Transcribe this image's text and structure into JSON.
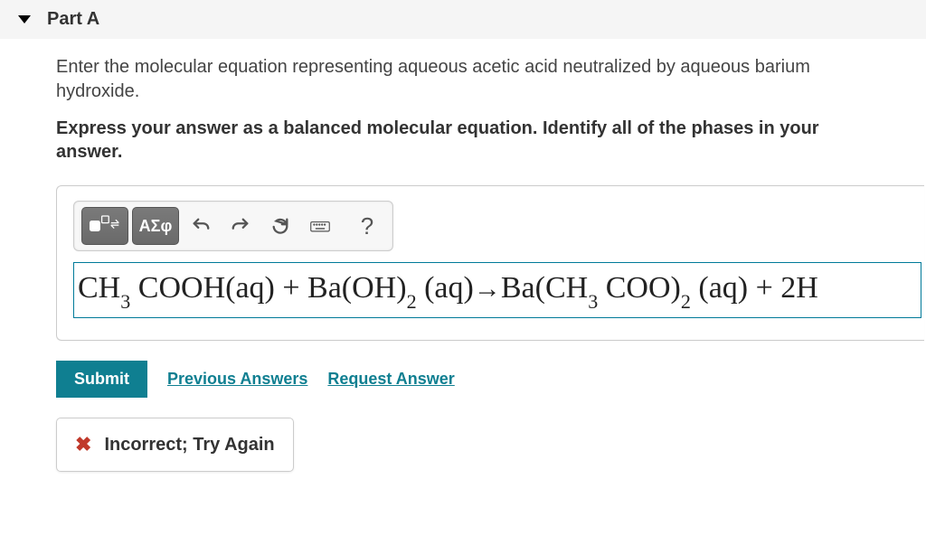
{
  "part": {
    "title": "Part A"
  },
  "question": {
    "prompt": "Enter the molecular equation representing aqueous acetic acid neutralized by aqueous barium hydroxide.",
    "instructions": "Express your answer as a balanced molecular equation. Identify all of the phases in your answer."
  },
  "toolbar": {
    "symbols_label": "ΑΣφ",
    "help_label": "?"
  },
  "answer": {
    "equation_html": "CH<sub>3</sub> COOH(aq) + Ba(OH)<sub>2</sub> (aq)<span class='arrow'>→</span>Ba(CH<sub>3</sub> COO)<sub>2</sub> (aq) + 2H"
  },
  "actions": {
    "submit": "Submit",
    "previous_answers": "Previous Answers",
    "request_answer": "Request Answer"
  },
  "feedback": {
    "message": "Incorrect; Try Again"
  }
}
